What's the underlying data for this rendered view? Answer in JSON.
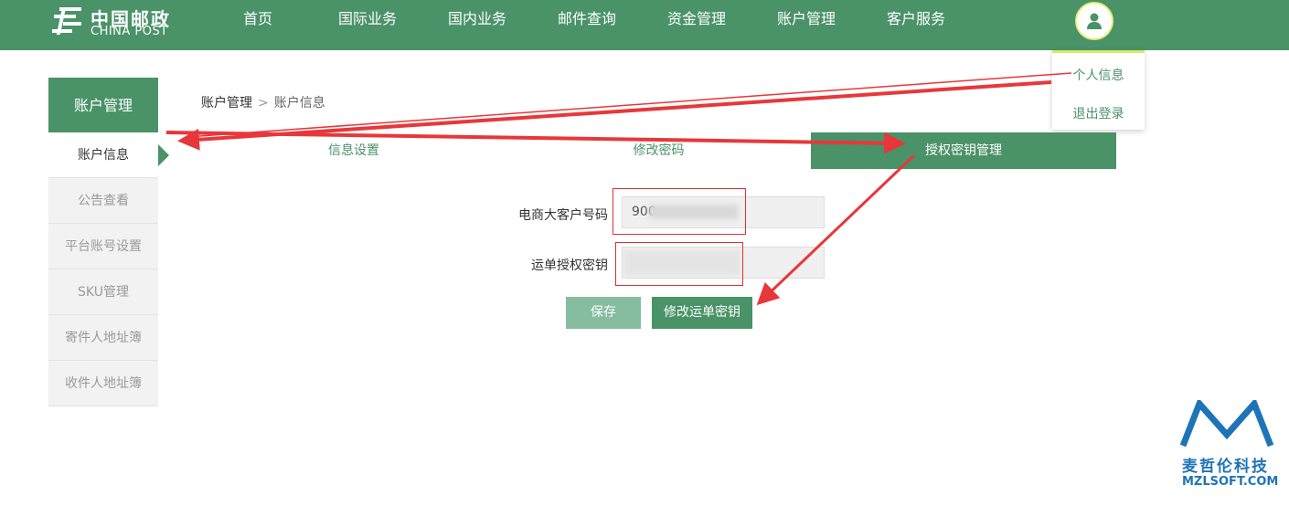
{
  "header": {
    "logo_cn": "中国邮政",
    "logo_en": "CHINA POST",
    "nav": [
      {
        "label": "首页"
      },
      {
        "label": "国际业务"
      },
      {
        "label": "国内业务"
      },
      {
        "label": "邮件查询"
      },
      {
        "label": "资金管理"
      },
      {
        "label": "账户管理"
      },
      {
        "label": "客户服务"
      }
    ],
    "user_menu": [
      {
        "label": "个人信息"
      },
      {
        "label": "退出登录"
      }
    ]
  },
  "sidebar": {
    "title": "账户管理",
    "items": [
      {
        "label": "账户信息",
        "active": true
      },
      {
        "label": "公告查看"
      },
      {
        "label": "平台账号设置"
      },
      {
        "label": "SKU管理"
      },
      {
        "label": "寄件人地址簿"
      },
      {
        "label": "收件人地址簿"
      }
    ]
  },
  "breadcrumb": {
    "level1": "账户管理",
    "separator": ">",
    "level2": "账户信息"
  },
  "tabs": [
    {
      "label": "信息设置"
    },
    {
      "label": "修改密码"
    },
    {
      "label": "授权密钥管理",
      "active": true
    }
  ],
  "form": {
    "customer_no_label": "电商大客户号码",
    "customer_no_value": "900",
    "waybill_key_label": "运单授权密钥",
    "waybill_key_value": ""
  },
  "buttons": {
    "save": "保存",
    "modify_key": "修改运单密钥"
  },
  "watermark": {
    "cn": "麦哲伦科技",
    "en": "MZLSOFT.COM"
  },
  "colors": {
    "primary_green": "#4a9268",
    "light_green": "#86bca0",
    "annotation_red": "#e8373a",
    "watermark_blue": "#1f74b8"
  }
}
